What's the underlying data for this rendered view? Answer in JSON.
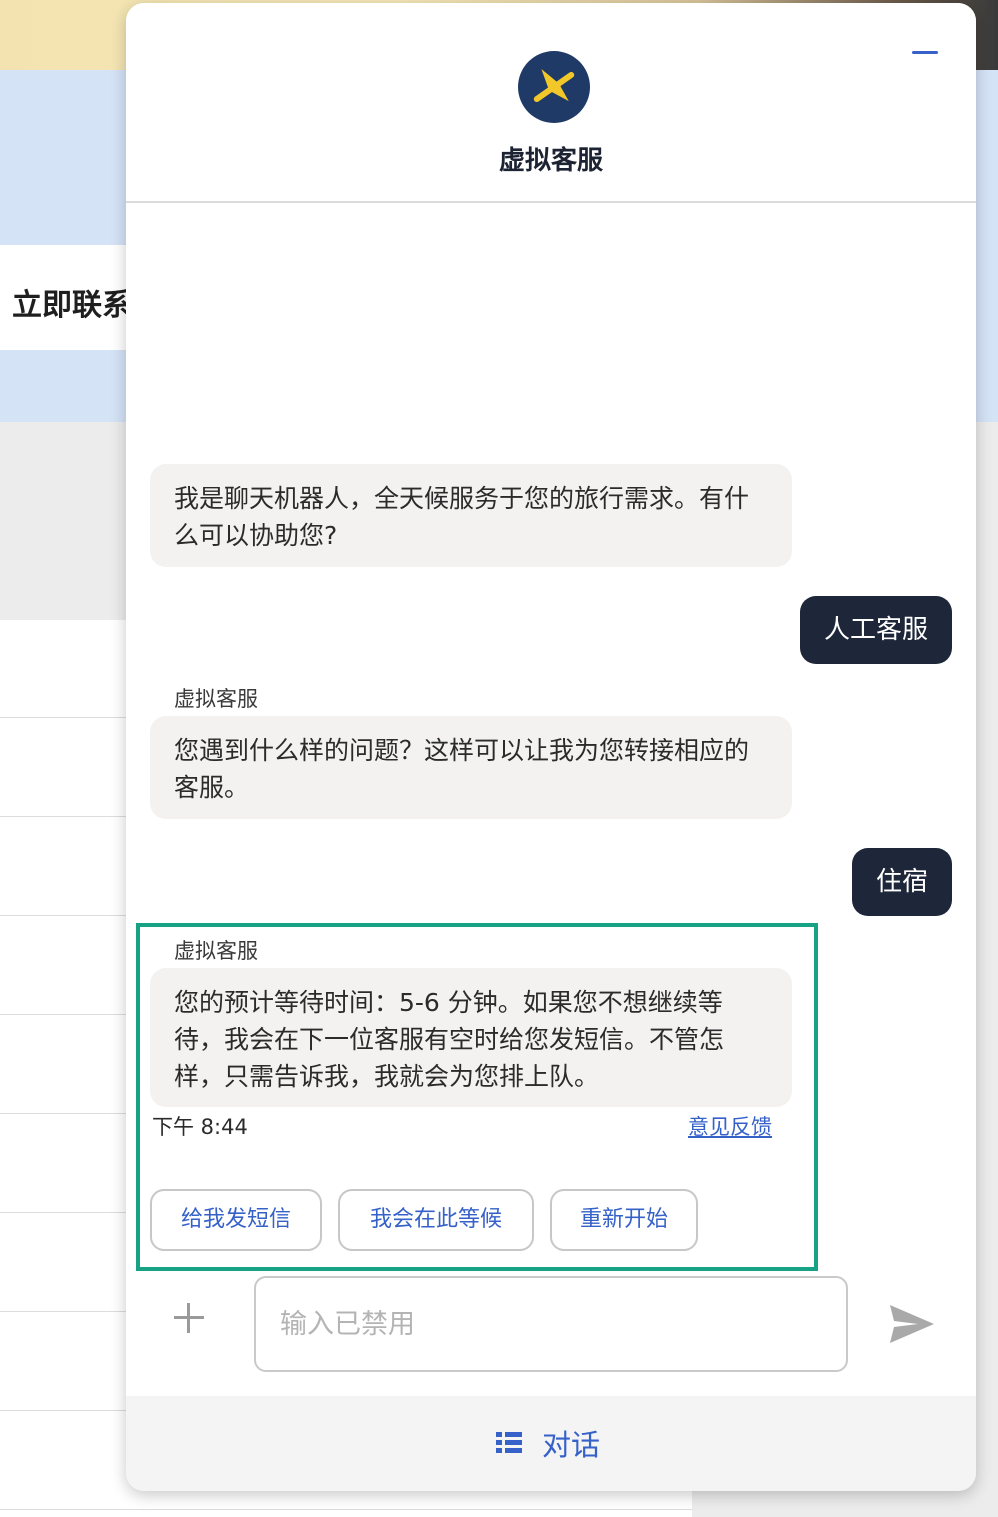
{
  "background": {
    "heading": "立即联系"
  },
  "chat": {
    "title": "虚拟客服",
    "messages": [
      {
        "type": "bot",
        "text": "我是聊天机器人，全天候服务于您的旅行需求。有什么可以协助您?"
      },
      {
        "type": "user",
        "text": "人工客服"
      },
      {
        "type": "bot",
        "sender": "虚拟客服",
        "text": "您遇到什么样的问题？这样可以让我为您转接相应的客服。"
      },
      {
        "type": "user",
        "text": "住宿"
      },
      {
        "type": "bot",
        "sender": "虚拟客服",
        "text": "您的预计等待时间：5-6 分钟。如果您不想继续等待，我会在下一位客服有空时给您发短信。不管怎样，只需告诉我，我就会为您排上队。"
      }
    ],
    "timestamp": "下午 8:44",
    "feedback_label": "意见反馈",
    "quick_replies": [
      "给我发短信",
      "我会在此等候",
      "重新开始"
    ],
    "input_placeholder": "输入已禁用",
    "footer_label": "对话",
    "colors": {
      "accent": "#3561c9",
      "user_bubble": "#1e2639",
      "bot_bubble": "#f3f2f1",
      "highlight": "#17a185",
      "logo_bg": "#1f3a66",
      "logo_plane": "#f2c72a"
    },
    "icons": [
      "minimize-icon",
      "expedia-logo-icon",
      "plus-icon",
      "send-icon",
      "list-icon"
    ]
  }
}
